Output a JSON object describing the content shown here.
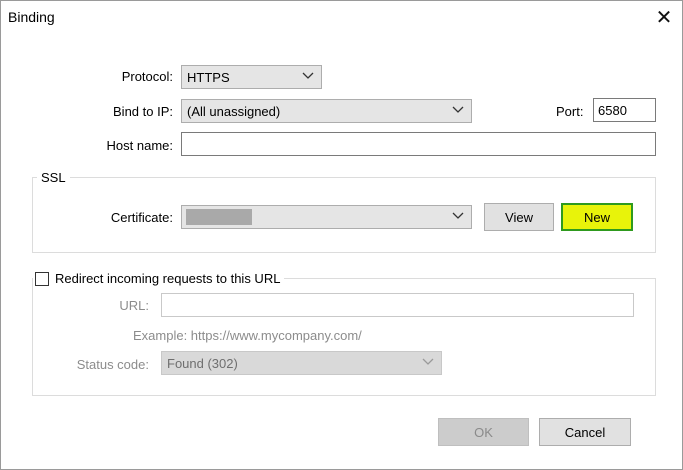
{
  "window": {
    "title": "Binding",
    "close_glyph": "✕"
  },
  "protocol": {
    "label": "Protocol:",
    "value": "HTTPS"
  },
  "bind_ip": {
    "label": "Bind to IP:",
    "value": "(All unassigned)"
  },
  "port": {
    "label": "Port:",
    "value": "6580"
  },
  "host": {
    "label": "Host name:",
    "value": ""
  },
  "ssl": {
    "group_label": "SSL",
    "certificate_label": "Certificate:",
    "certificate_value": "",
    "view_label": "View",
    "new_label": "New"
  },
  "redirect": {
    "checkbox_label": "Redirect incoming requests to this URL",
    "checked": false,
    "url_label": "URL:",
    "url_value": "",
    "example_text": "Example: https://www.mycompany.com/",
    "status_label": "Status code:",
    "status_value": "Found (302)"
  },
  "footer": {
    "ok_label": "OK",
    "cancel_label": "Cancel"
  },
  "colors": {
    "highlight": "#e8f30a",
    "highlight_border": "#2e9a1e"
  }
}
